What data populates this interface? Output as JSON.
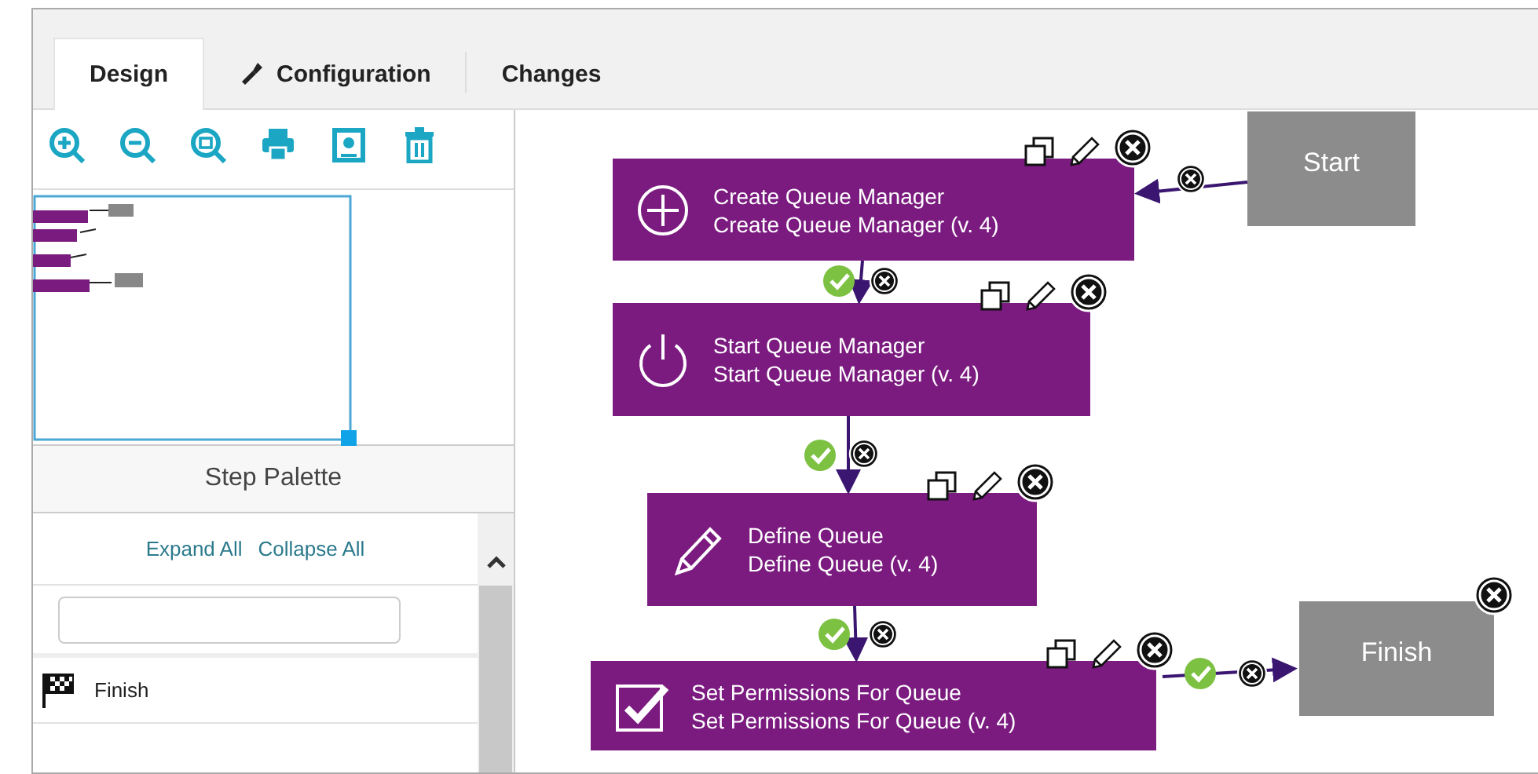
{
  "tabs": [
    {
      "label": "Design",
      "selected": true,
      "kind": "plain"
    },
    {
      "label": "Configuration",
      "selected": false,
      "kind": "wrench"
    },
    {
      "label": "Changes",
      "selected": false,
      "kind": "plain"
    }
  ],
  "palette": {
    "title": "Step Palette",
    "links": [
      "Expand All",
      "Collapse All"
    ],
    "items": [
      {
        "label": "Finish",
        "kind": "flag"
      }
    ]
  },
  "flow": {
    "nodes": [
      {
        "kind": "terminal",
        "title": "Start"
      },
      {
        "kind": "plus",
        "title": "Create Queue Manager",
        "subtitle": "Create Queue Manager (v. 4)"
      },
      {
        "kind": "power",
        "title": "Start Queue Manager",
        "subtitle": "Start Queue Manager (v. 4)"
      },
      {
        "kind": "pencil",
        "title": "Define Queue",
        "subtitle": "Define Queue (v. 4)"
      },
      {
        "kind": "checkbox",
        "title": "Set Permissions For Queue",
        "subtitle": "Set Permissions For Queue (v. 4)"
      },
      {
        "kind": "terminal",
        "title": "Finish"
      }
    ]
  }
}
